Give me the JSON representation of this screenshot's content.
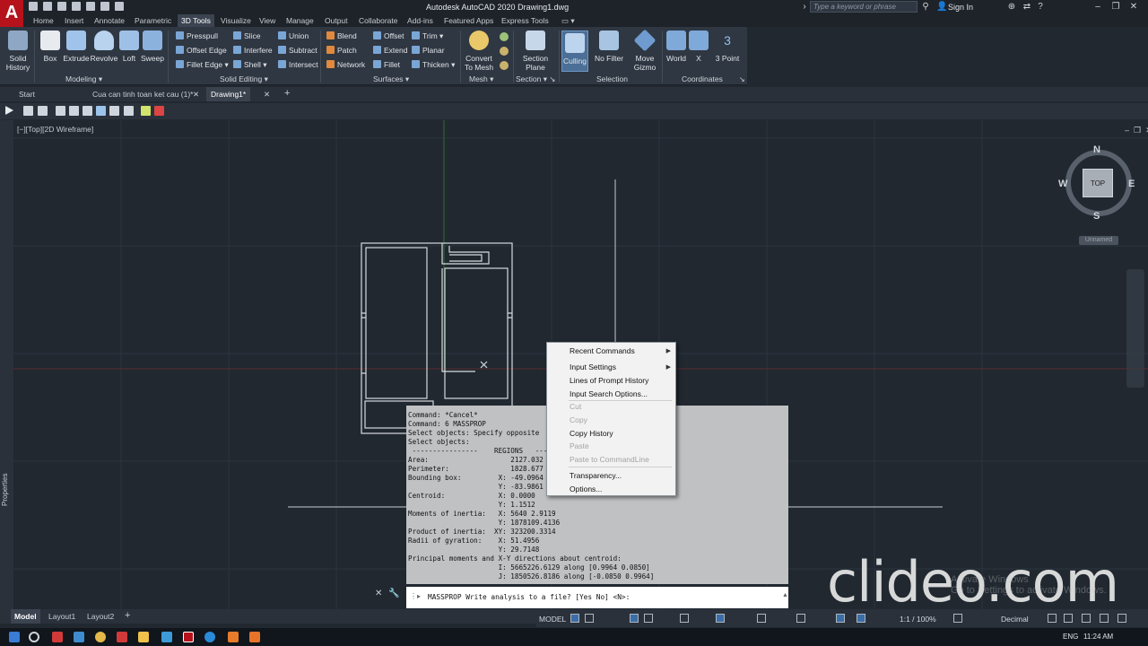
{
  "titlebar": {
    "app_logo": "A",
    "title": "Autodesk AutoCAD 2020   Drawing1.dwg",
    "search_placeholder": "Type a keyword or phrase",
    "signin": "Sign In"
  },
  "menu_tabs": [
    "Home",
    "Insert",
    "Annotate",
    "Parametric",
    "3D Tools",
    "Visualize",
    "View",
    "Manage",
    "Output",
    "Collaborate",
    "Add-ins",
    "Featured Apps",
    "Express Tools"
  ],
  "active_menu_tab": "3D Tools",
  "ribbon": {
    "solid_history": "Solid\nHistory",
    "box": "Box",
    "extrude": "Extrude",
    "revolve": "Revolve",
    "loft": "Loft",
    "sweep": "Sweep",
    "modeling": "Modeling",
    "presspull": "Presspull",
    "offset_edge": "Offset Edge",
    "fillet_edge": "Fillet Edge",
    "slice": "Slice",
    "interfere": "Interfere",
    "shell": "Shell",
    "union": "Union",
    "subtract": "Subtract",
    "intersect": "Intersect",
    "solid_editing": "Solid Editing",
    "blend": "Blend",
    "patch": "Patch",
    "network": "Network",
    "offset": "Offset",
    "extend": "Extend",
    "fillet": "Fillet",
    "trim": "Trim",
    "planar": "Planar",
    "thicken": "Thicken",
    "surfaces": "Surfaces",
    "convert_to_mesh": "Convert\nTo Mesh",
    "mesh": "Mesh",
    "section_plane": "Section\nPlane",
    "section": "Section",
    "culling": "Culling",
    "no_filter": "No Filter",
    "move_gizmo": "Move\nGizmo",
    "selection": "Selection",
    "world": "World",
    "x": "X",
    "three_point": "3 Point",
    "three": "3",
    "coordinates": "Coordinates"
  },
  "file_tabs": [
    "Start",
    "Cua can tinh toan ket cau (1)*",
    "Drawing1*"
  ],
  "viewport_label": "[−][Top][2D Wireframe]",
  "properties_label": "Properties",
  "viewcube": {
    "n": "N",
    "s": "S",
    "e": "E",
    "w": "W",
    "top": "TOP",
    "unnamed": "Unnamed"
  },
  "command_history": "Command: *Cancel*\nCommand: 6 MASSPROP\nSelect objects: Specify opposite\nSelect objects:\n ----------------    REGIONS   ---\nArea:                    2127.032\nPerimeter:               1828.677\nBounding box:         X: -49.0964\n                      Y: -83.9861\nCentroid:             X: 0.0000\n                      Y: 1.1512\nMoments of inertia:   X: 5640 2.9119\n                      Y: 1878109.4136\nProduct of inertia:  XY: 323200.3314\nRadii of gyration:    X: 51.4956\n                      Y: 29.7148\nPrincipal moments and X-Y directions about centroid:\n                      I: 5665226.6129 along [0.9964 0.0850]\n                      J: 1850526.8186 along [-0.0850 0.9964]",
  "command_prompt": "MASSPROP Write analysis to a file? [Yes No] <N>:",
  "context_menu": [
    {
      "label": "Recent Commands",
      "submenu": true,
      "enabled": true
    },
    {
      "label": "Input Settings",
      "submenu": true,
      "enabled": true
    },
    {
      "label": "Lines of Prompt History",
      "submenu": false,
      "enabled": true
    },
    {
      "label": "Input Search Options...",
      "submenu": false,
      "enabled": true
    },
    {
      "label": "Cut",
      "submenu": false,
      "enabled": false
    },
    {
      "label": "Copy",
      "submenu": false,
      "enabled": false
    },
    {
      "label": "Copy History",
      "submenu": false,
      "enabled": true
    },
    {
      "label": "Paste",
      "submenu": false,
      "enabled": false
    },
    {
      "label": "Paste to CommandLine",
      "submenu": false,
      "enabled": false
    },
    {
      "label": "Transparency...",
      "submenu": false,
      "enabled": true
    },
    {
      "label": "Options...",
      "submenu": false,
      "enabled": true
    }
  ],
  "layout_tabs": [
    "Model",
    "Layout1",
    "Layout2"
  ],
  "statusbar": {
    "model": "MODEL",
    "scale": "1:1 / 100%",
    "units": "Decimal"
  },
  "taskbar": {
    "lang": "ENG",
    "time": "11:24 AM"
  },
  "watermark": {
    "brand": "clideo.com",
    "activate_line1": "Activate Windows",
    "activate_line2": "Go to Settings to activate Windows."
  },
  "colors": {
    "ribbon_bg": "#2f3742",
    "canvas_bg": "#212830",
    "autocad_red": "#b5121b",
    "command_history_bg": "#bfc1c3"
  }
}
